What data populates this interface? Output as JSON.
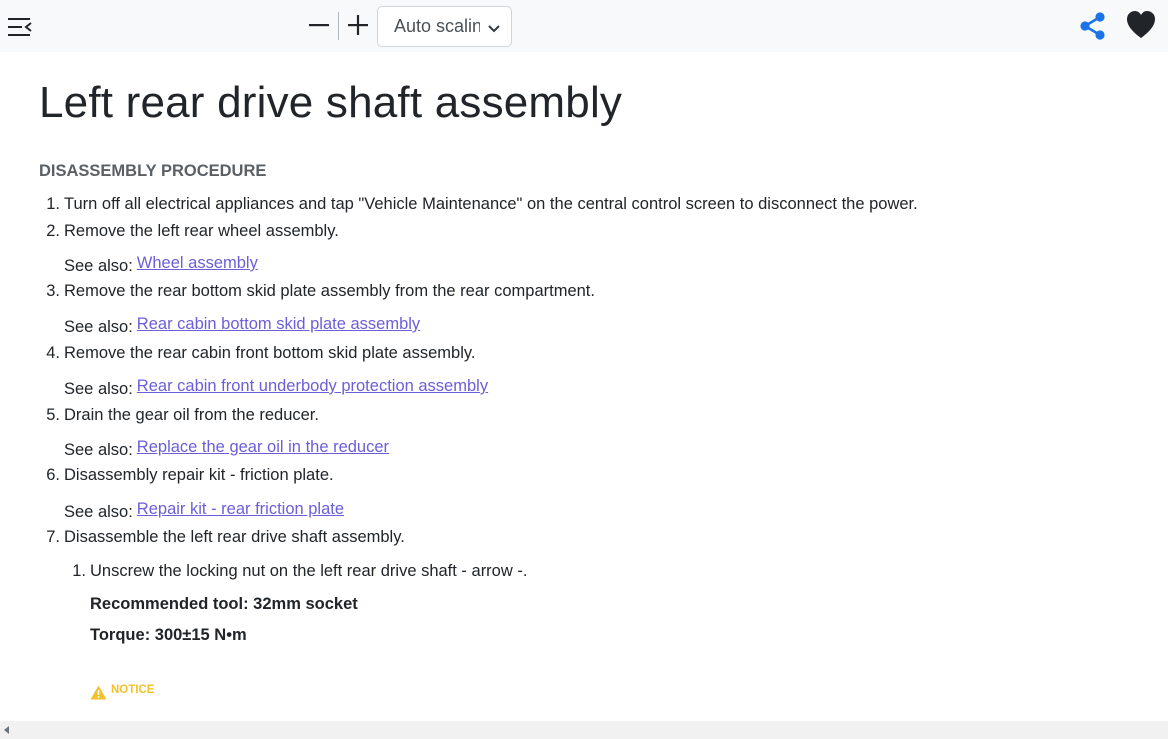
{
  "toolbar": {
    "zoom_value": "Auto scaling",
    "zoom_options": [
      "Auto scaling"
    ],
    "colors": {
      "accent": "#1a73e8",
      "background": "#f8f9fa",
      "notice": "#f2c12e",
      "link": "#6a5fd8"
    },
    "icons": [
      "menu-icon",
      "minus-icon",
      "plus-icon",
      "chevron-down-icon",
      "share-icon",
      "heart-icon"
    ]
  },
  "page": {
    "title": "Left rear drive shaft assembly",
    "section": "DISASSEMBLY PROCEDURE",
    "see_also_label": "See also:",
    "steps": [
      {
        "n": "1.",
        "text": "Turn off all electrical appliances and tap \"Vehicle Maintenance\" on the central control screen to disconnect the power."
      },
      {
        "n": "2.",
        "text": "Remove the left rear wheel assembly.",
        "link": "Wheel assembly"
      },
      {
        "n": "3.",
        "text": "Remove the rear bottom skid plate assembly from the rear compartment.",
        "link": "Rear cabin bottom skid plate assembly"
      },
      {
        "n": "4.",
        "text": "Remove the rear cabin front bottom skid plate assembly.",
        "link": "Rear cabin front underbody protection assembly"
      },
      {
        "n": "5.",
        "text": "Drain the gear oil from the reducer.",
        "link": "Replace the gear oil in the reducer"
      },
      {
        "n": "6.",
        "text": "Disassembly repair kit - friction plate.",
        "link": "Repair kit - rear friction plate"
      },
      {
        "n": "7.",
        "text": "Disassemble the left rear drive shaft assembly."
      }
    ],
    "substeps": [
      {
        "n": "1.",
        "text": "Unscrew the locking nut on the left rear drive shaft - arrow -."
      }
    ],
    "recommended_tool": "Recommended tool: 32mm socket",
    "torque": "Torque: 300±15 N•m",
    "notice_label": "NOTICE"
  }
}
